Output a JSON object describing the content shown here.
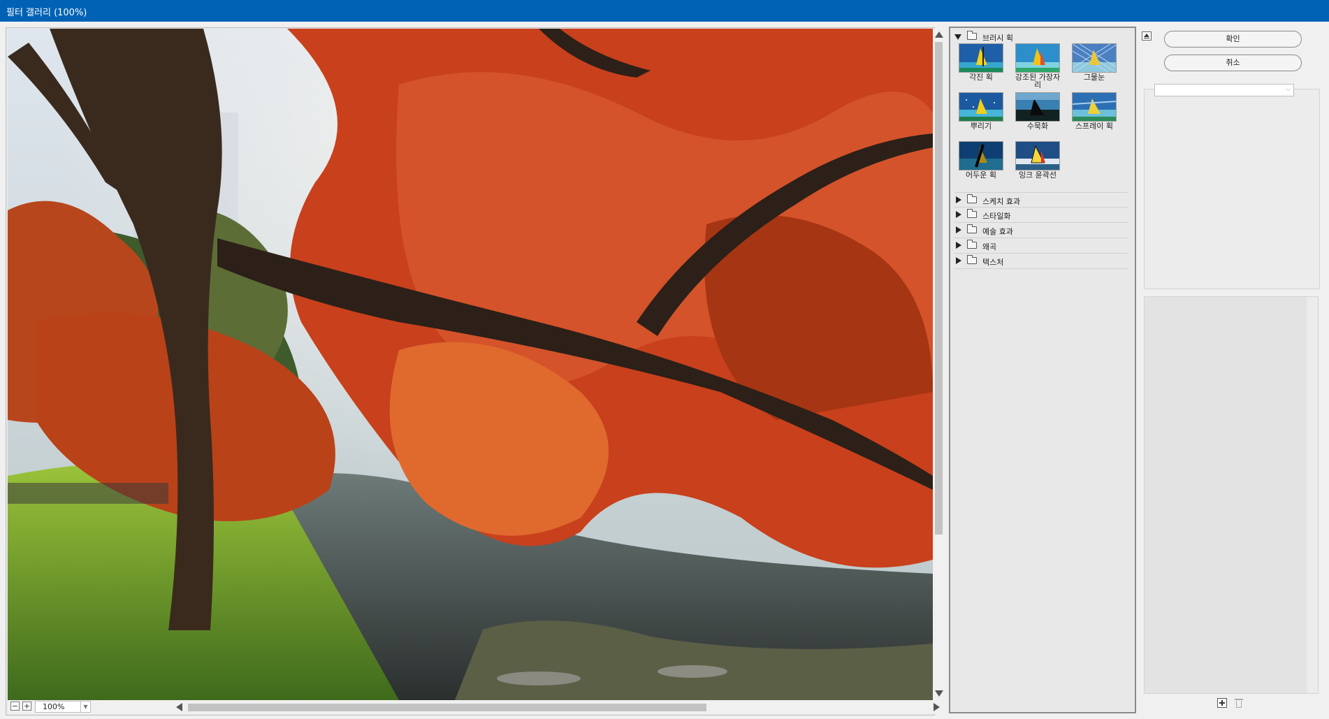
{
  "window": {
    "title": "필터 갤러리 (100%)"
  },
  "preview": {
    "zoom": "100%",
    "zoom_out": "−",
    "zoom_in": "+"
  },
  "filters": {
    "categories": [
      {
        "name": "브러시 획",
        "expanded": true,
        "items": [
          {
            "label": "각진 획"
          },
          {
            "label": "강조된 가장자리"
          },
          {
            "label": "그물눈"
          },
          {
            "label": "뿌리기"
          },
          {
            "label": "수묵화"
          },
          {
            "label": "스프레이 획"
          },
          {
            "label": "어두운 획"
          },
          {
            "label": "잉크 윤곽선"
          }
        ]
      },
      {
        "name": "스케치 효과",
        "expanded": false
      },
      {
        "name": "스타일화",
        "expanded": false
      },
      {
        "name": "예술 효과",
        "expanded": false
      },
      {
        "name": "왜곡",
        "expanded": false
      },
      {
        "name": "텍스처",
        "expanded": false
      }
    ]
  },
  "actions": {
    "ok": "확인",
    "cancel": "취소"
  },
  "colors": {
    "titlebar": "#0062b5",
    "accent_foliage": "#c8401c"
  }
}
